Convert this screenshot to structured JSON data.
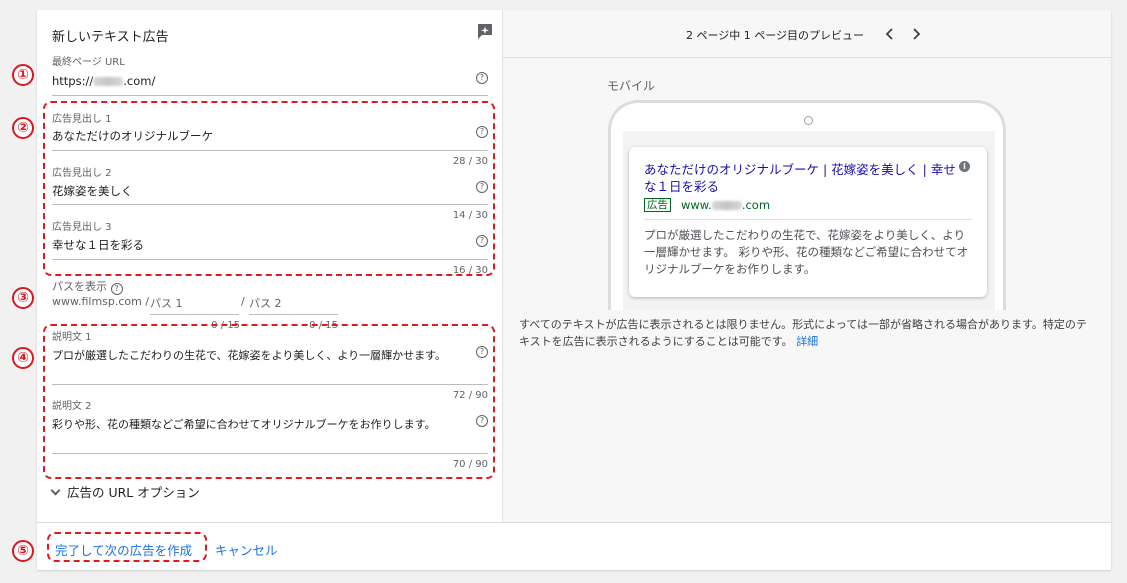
{
  "form": {
    "title": "新しいテキスト広告",
    "final_url": {
      "label": "最終ページ URL",
      "value_prefix": "https://",
      "value_suffix": ".com/"
    },
    "headline1": {
      "label": "広告見出し 1",
      "value": "あなただけのオリジナルブーケ",
      "counter": "28 / 30"
    },
    "headline2": {
      "label": "広告見出し 2",
      "value": "花嫁姿を美しく",
      "counter": "14 / 30"
    },
    "headline3": {
      "label": "広告見出し 3",
      "value": "幸せな１日を彩る",
      "counter": "16 / 30"
    },
    "path": {
      "label": "パスを表示",
      "domain": "www.filmsp.com",
      "sep1": "/",
      "path1_placeholder": "パス 1",
      "sep2": "/",
      "path2_placeholder": "パス 2",
      "counter1": "0 / 15",
      "counter2": "0 / 15"
    },
    "desc1": {
      "label": "説明文 1",
      "value": "プロが厳選したこだわりの生花で、花嫁姿をより美しく、より一層輝かせます。",
      "counter": "72 / 90"
    },
    "desc2": {
      "label": "説明文 2",
      "value": "彩りや形、花の種類などご希望に合わせてオリジナルブーケをお作りします。",
      "counter": "70 / 90"
    },
    "url_options": "広告の URL オプション"
  },
  "help_symbol": "?",
  "markers": [
    "①",
    "②",
    "③",
    "④",
    "⑤"
  ],
  "preview": {
    "title": "2 ページ中 1 ページ目のプレビュー",
    "mobile_label": "モバイル",
    "ad": {
      "headline": "あなただけのオリジナルブーケ | 花嫁姿を美しく | 幸せな１日を彩る",
      "info": "i",
      "badge": "広告",
      "url_prefix": "www.",
      "url_suffix": ".com",
      "description": "プロが厳選したこだわりの生花で、花嫁姿をより美しく、より一層輝かせます。 彩りや形、花の種類などご希望に合わせてオリジナルブーケをお作りします。"
    },
    "note": "すべてのテキストが広告に表示されるとは限りません。形式によっては一部が省略される場合があります。特定のテキストを広告に表示されるようにすることは可能です。",
    "note_link": "詳細"
  },
  "footer": {
    "done": "完了して次の広告を作成",
    "cancel": "キャンセル"
  },
  "colors": {
    "accent_red": "#d71a1f",
    "link_blue": "#1a73e8",
    "ad_title": "#1a0dab",
    "ad_green": "#006621"
  }
}
